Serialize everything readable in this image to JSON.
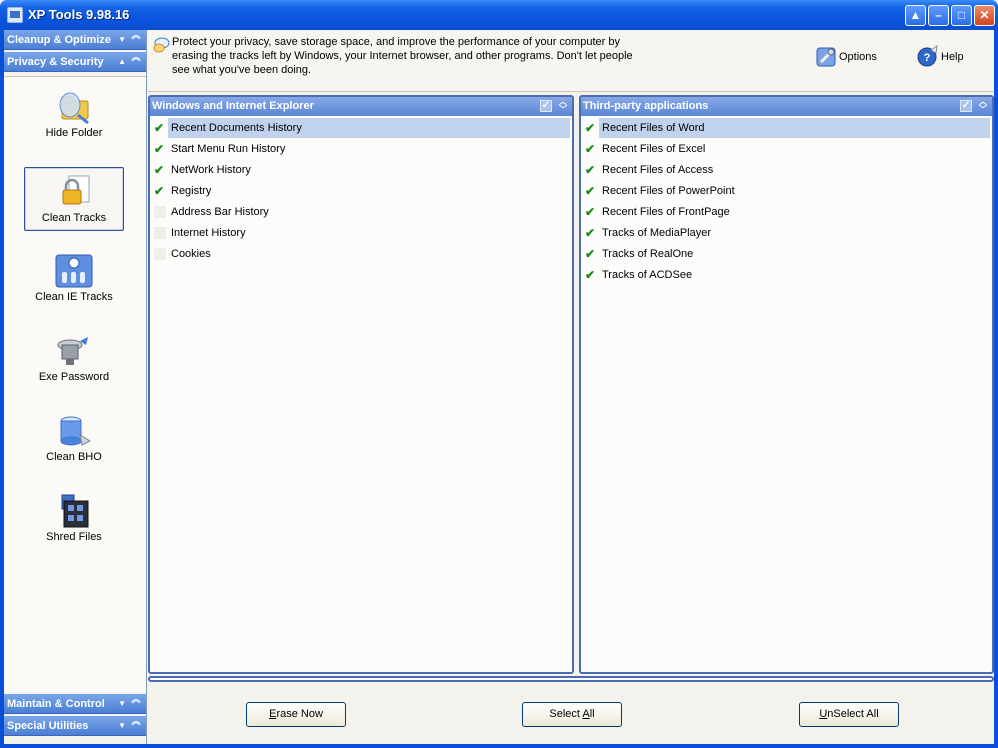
{
  "window": {
    "title": "XP Tools 9.98.16"
  },
  "title_buttons": [
    "▲",
    "–",
    "□",
    "✕"
  ],
  "nav": {
    "categories_top": [
      {
        "label": "Cleanup & Optimize"
      },
      {
        "label": "Privacy & Security"
      }
    ],
    "items": [
      {
        "label": "Hide Folder",
        "icon": "hide-folder-icon"
      },
      {
        "label": "Clean Tracks",
        "icon": "lock-document-icon",
        "selected": true
      },
      {
        "label": "Clean IE Tracks",
        "icon": "ie-tracks-icon"
      },
      {
        "label": "Exe Password",
        "icon": "exe-password-icon"
      },
      {
        "label": "Clean BHO",
        "icon": "bho-icon"
      },
      {
        "label": "Shred Files",
        "icon": "shred-files-icon"
      }
    ],
    "categories_bottom": [
      {
        "label": "Maintain & Control"
      },
      {
        "label": "Special Utilities"
      }
    ]
  },
  "header": {
    "description": "Protect your privacy, save storage space, and improve the performance of your computer by erasing the tracks left by Windows, your Internet browser, and other programs. Don't let people see what you've been doing.",
    "options_label": "Options",
    "help_label": "Help"
  },
  "left_panel": {
    "title": "Windows and Internet Explorer",
    "items": [
      {
        "label": "Recent Documents History",
        "checked": true,
        "selected": true
      },
      {
        "label": "Start Menu Run History",
        "checked": true
      },
      {
        "label": "NetWork History",
        "checked": true
      },
      {
        "label": "Registry",
        "checked": true
      },
      {
        "label": "Address Bar History",
        "checked": false
      },
      {
        "label": "Internet History",
        "checked": false
      },
      {
        "label": "Cookies",
        "checked": false
      }
    ]
  },
  "right_panel": {
    "title": "Third-party applications",
    "items": [
      {
        "label": "Recent Files of Word",
        "checked": true,
        "selected": true
      },
      {
        "label": "Recent Files of Excel",
        "checked": true
      },
      {
        "label": "Recent Files of Access",
        "checked": true
      },
      {
        "label": "Recent Files of PowerPoint",
        "checked": true
      },
      {
        "label": "Recent Files of FrontPage",
        "checked": true
      },
      {
        "label": "Tracks of MediaPlayer",
        "checked": true
      },
      {
        "label": "Tracks of RealOne",
        "checked": true
      },
      {
        "label": "Tracks of ACDSee",
        "checked": true
      }
    ]
  },
  "buttons": {
    "erase_now": {
      "mnemonic": "E",
      "rest": "rase Now"
    },
    "select_all": {
      "before": "Select ",
      "mnemonic": "A",
      "rest": "ll"
    },
    "unselect_all": {
      "mnemonic": "U",
      "rest": "nSelect All"
    }
  },
  "colors": {
    "accent": "#0a55df",
    "panel_header": "#5a86d6",
    "selection": "#c1d2ee",
    "check": "#1d8a1d"
  }
}
